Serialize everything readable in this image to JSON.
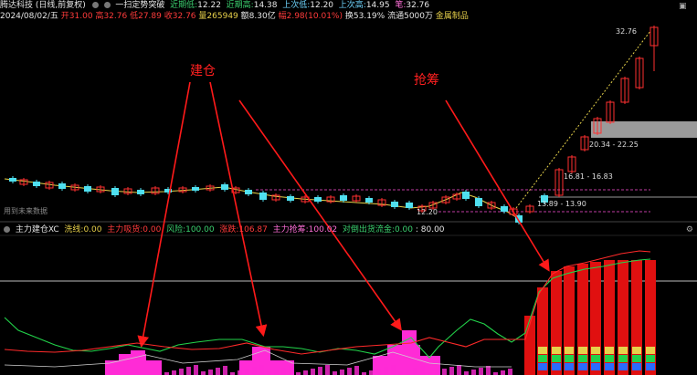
{
  "header": {
    "stock_name": "腾达科技 (日线,前复权)",
    "indicator_name": "一扫定势突破",
    "low_recent_label": "近期低:",
    "low_recent": "12.22",
    "high_recent_label": "近期高:",
    "high_recent": "14.38",
    "prev_low_label": "上次低:",
    "prev_low": "12.20",
    "prev_high_label": "上次高:",
    "prev_high": "14.95",
    "pen_label": "笔:",
    "pen": "32.76"
  },
  "ohlc": {
    "date": "2024/08/02/五",
    "open_label": "开",
    "open": "31.00",
    "high_label": "高",
    "high": "32.76",
    "low_label": "低",
    "low": "27.89",
    "close_label": "收",
    "close": "32.76",
    "vol_label": "量",
    "vol": "265949",
    "amt_label": "额",
    "amt": "8.30亿",
    "chg_label": "幅",
    "chg": "2.98(10.01%)",
    "turn_label": "换",
    "turn": "53.19%",
    "float_label": "流通",
    "float": "5000万",
    "sector": "金属制品"
  },
  "annotations": {
    "jiancang": "建仓",
    "qiangchou": "抢筹",
    "future_data": "用到未来数据"
  },
  "price_labels": {
    "top": "32.76",
    "range1": "20.34 - 22.25",
    "range2": "16.81 - 16.83",
    "range3": "13.89 - 13.90",
    "low": "12.20"
  },
  "indicator": {
    "name": "主力建仓XC",
    "wash_label": "洗线:",
    "wash": "0.00",
    "suck_label": "主力吸货:",
    "suck": "0.00",
    "risk_label": "风险:",
    "risk": "100.00",
    "rise_label": "涨跌:",
    "rise": "106.87",
    "grab_label": "主力抢筹:",
    "grab": "100.02",
    "flow_label": "对倒出货流金:",
    "flow": "0.00",
    "extra": ": 80.00"
  },
  "colors": {
    "up": "#ff3030",
    "down": "#4fe0f0",
    "ma": "#e6d24a",
    "green_line": "#22d34a",
    "red_line": "#ff2a2a",
    "magenta": "#ff2bd6"
  }
}
